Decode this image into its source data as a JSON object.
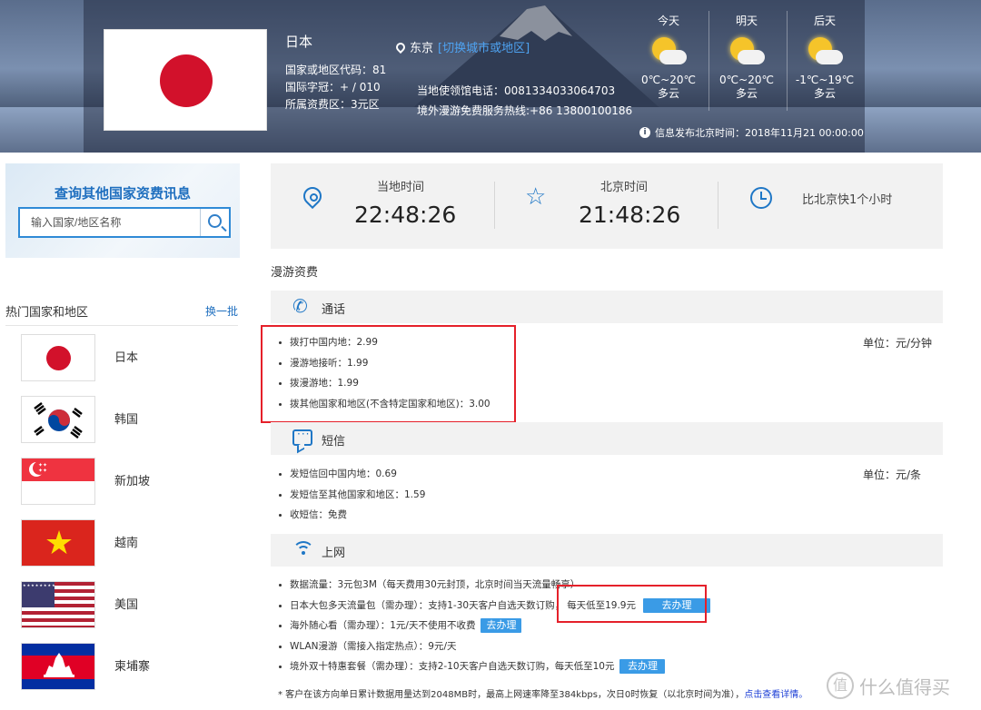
{
  "header": {
    "country_name": "日本",
    "country_code": "国家或地区代码：81",
    "intl_prefix": "国际字冠：+ / 010",
    "rate_zone": "所属资费区：3元区",
    "city": "东京",
    "switch_city": "[切换城市或地区]",
    "consulate_phone": "当地使领馆电话：0081334033064703",
    "hotline": "境外漫游免费服务热线:+86 13800100186",
    "notice": "信息发布北京时间：2018年11月21 00:00:00"
  },
  "weather": [
    {
      "day": "今天",
      "temp": "0℃~20℃",
      "cond": "多云",
      "icon": "partly-cloudy-icon"
    },
    {
      "day": "明天",
      "temp": "0℃~20℃",
      "cond": "多云",
      "icon": "partly-cloudy-icon"
    },
    {
      "day": "后天",
      "temp": "-1℃~19℃",
      "cond": "多云",
      "icon": "partly-cloudy-icon"
    }
  ],
  "search": {
    "title": "查询其他国家资费讯息",
    "placeholder": "输入国家/地区名称"
  },
  "hot": {
    "title": "热门国家和地区",
    "refresh": "换一批",
    "countries": [
      {
        "name": "日本",
        "flag": "japan-flag"
      },
      {
        "name": "韩国",
        "flag": "korea-flag"
      },
      {
        "name": "新加坡",
        "flag": "singapore-flag"
      },
      {
        "name": "越南",
        "flag": "vietnam-flag"
      },
      {
        "name": "美国",
        "flag": "usa-flag"
      },
      {
        "name": "柬埔寨",
        "flag": "cambodia-flag"
      }
    ]
  },
  "time": {
    "local_label": "当地时间",
    "local_time": "22:48:26",
    "beijing_label": "北京时间",
    "beijing_time": "21:48:26",
    "diff": "比北京快1个小时"
  },
  "roaming": {
    "title": "漫游资费",
    "call": {
      "label": "通话",
      "unit": "单位：元/分钟",
      "items": [
        "拨打中国内地：2.99",
        "漫游地接听：1.99",
        "拨漫游地：1.99",
        "拨其他国家和地区(不含特定国家和地区)：3.00"
      ]
    },
    "sms": {
      "label": "短信",
      "unit": "单位：元/条",
      "items": [
        "发短信回中国内地：0.69",
        "发短信至其他国家和地区：1.59",
        "收短信：免费"
      ]
    },
    "data": {
      "label": "上网",
      "items": [
        {
          "text": "数据流量：3元包3M（每天费用30元封顶，北京时间当天流量畅享）",
          "button": ""
        },
        {
          "text": "日本大包多天流量包（需办理）：支持1-30天客户自选天数订购，",
          "extra": "每天低至19.9元",
          "button": "去办理"
        },
        {
          "text": "海外随心看（需办理）：1元/天不使用不收费",
          "button": "去办理"
        },
        {
          "text": "WLAN漫游（需接入指定热点）：9元/天",
          "button": ""
        },
        {
          "text": "境外双十特惠套餐（需办理）：支持2-10天客户自选天数订购，每天低至10元",
          "button": "去办理"
        }
      ]
    },
    "footnote": "* 客户在该方向单日累计数据用量达到2048MB时，最高上网速率降至384kbps，次日0时恢复（以北京时间为准），",
    "footnote_link": "点击查看详情。"
  },
  "watermark": "什么值得买",
  "colors": {
    "accent": "#1f77c6",
    "highlight": "#e5202a",
    "button": "#3a9be6"
  }
}
